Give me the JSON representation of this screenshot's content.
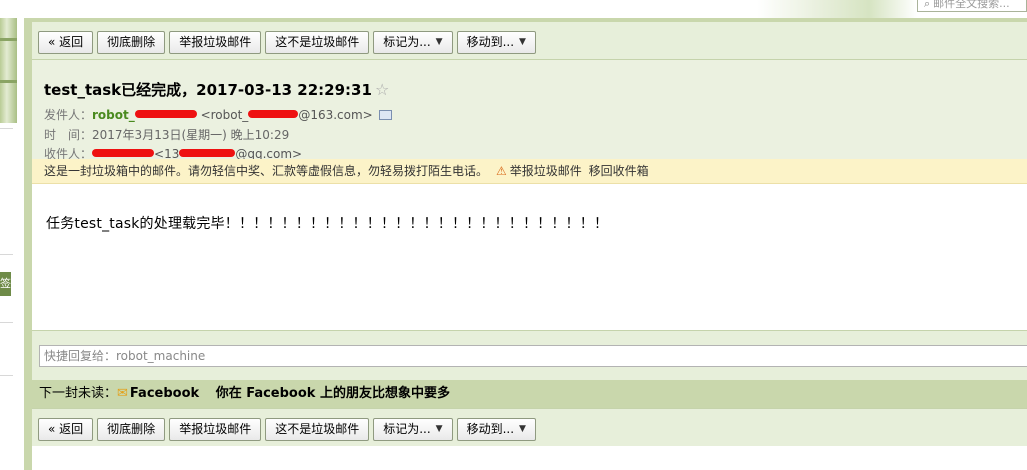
{
  "search": {
    "placeholder": "邮件全文搜索..."
  },
  "left_tag": "签",
  "toolbar": {
    "back": "« 返回",
    "delete_forever": "彻底删除",
    "report_spam": "举报垃圾邮件",
    "not_spam": "这不是垃圾邮件",
    "mark_as": "标记为...",
    "move_to": "移动到..."
  },
  "email": {
    "subject": "test_task已经完成，2017-03-13 22:29:31",
    "star": "☆",
    "sender_label": "发件人：",
    "sender_name": "robot_",
    "sender_addr_prefix": "<robot_",
    "sender_addr_suffix": "@163.com>",
    "time_label": "时　间：",
    "time_value": "2017年3月13日(星期一) 晚上10:29",
    "recipient_label": "收件人：",
    "recipient_addr_prefix": "<13",
    "recipient_addr_suffix": "@qq.com>",
    "body": "任务test_task的处理载完毕！！！！！！！！！！！！！！！！！！！！！！！！！！！"
  },
  "warning": {
    "text": "这是一封垃圾箱中的邮件。请勿轻信中奖、汇款等虚假信息，勿轻易拨打陌生电话。",
    "report_link": "举报垃圾邮件",
    "move_link": "移回收件箱"
  },
  "reply": {
    "placeholder": "快捷回复给：robot_machine"
  },
  "next_email": {
    "label": "下一封未读：",
    "sender": "Facebook",
    "subject": "你在 Facebook 上的朋友比想象中要多"
  }
}
